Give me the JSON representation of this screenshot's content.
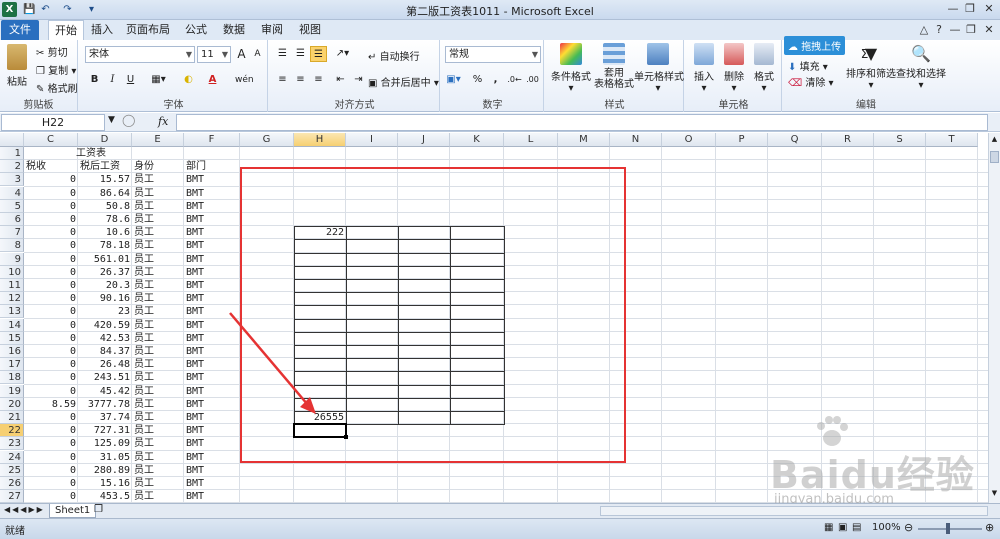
{
  "window": {
    "title": "第二版工资表1011 - Microsoft Excel"
  },
  "tabs": [
    "文件",
    "开始",
    "插入",
    "页面布局",
    "公式",
    "数据",
    "审阅",
    "视图"
  ],
  "ribbon": {
    "clipboard": {
      "paste": "粘贴",
      "cut": "剪切",
      "copy": "复制",
      "format_painter": "格式刷",
      "label": "剪贴板"
    },
    "font": {
      "name": "宋体",
      "size": "11",
      "bold": "B",
      "italic": "I",
      "underline": "U",
      "label": "字体",
      "grow": "A",
      "shrink": "A",
      "wen": "wén"
    },
    "alignment": {
      "wrap": "自动换行",
      "merge": "合并后居中",
      "label": "对齐方式"
    },
    "number": {
      "format": "常规",
      "percent": "%",
      "comma": ",",
      "label": "数字"
    },
    "styles": {
      "conditional": "条件格式",
      "table1": "套用",
      "table2": "表格格式",
      "cell_styles": "单元格样式",
      "label": "样式"
    },
    "cells": {
      "insert": "插入",
      "delete": "删除",
      "format": "格式",
      "label": "单元格"
    },
    "editing": {
      "baidu": "拖拽上传",
      "fill": "填充",
      "clear": "清除",
      "sort": "排序和筛选",
      "find": "查找和选择",
      "label": "编辑",
      "sum": "Σ"
    }
  },
  "formula_bar": {
    "name_box": "H22",
    "fx": "fx",
    "formula": ""
  },
  "columns": [
    "C",
    "D",
    "E",
    "F",
    "G",
    "H",
    "I",
    "J",
    "K",
    "L",
    "M",
    "N",
    "O",
    "P",
    "Q",
    "R",
    "S",
    "T"
  ],
  "sheet": {
    "title": "工资表",
    "headers": {
      "C": "税收",
      "D": "税后工资",
      "E": "身份",
      "F": "部门"
    },
    "rows": [
      {
        "r": 3,
        "C": "0",
        "D": "15.57",
        "E": "员工",
        "F": "BMT"
      },
      {
        "r": 4,
        "C": "0",
        "D": "86.64",
        "E": "员工",
        "F": "BMT"
      },
      {
        "r": 5,
        "C": "0",
        "D": "50.8",
        "E": "员工",
        "F": "BMT"
      },
      {
        "r": 6,
        "C": "0",
        "D": "78.6",
        "E": "员工",
        "F": "BMT"
      },
      {
        "r": 7,
        "C": "0",
        "D": "10.6",
        "E": "员工",
        "F": "BMT"
      },
      {
        "r": 8,
        "C": "0",
        "D": "78.18",
        "E": "员工",
        "F": "BMT"
      },
      {
        "r": 9,
        "C": "0",
        "D": "561.01",
        "E": "员工",
        "F": "BMT"
      },
      {
        "r": 10,
        "C": "0",
        "D": "26.37",
        "E": "员工",
        "F": "BMT"
      },
      {
        "r": 11,
        "C": "0",
        "D": "20.3",
        "E": "员工",
        "F": "BMT"
      },
      {
        "r": 12,
        "C": "0",
        "D": "90.16",
        "E": "员工",
        "F": "BMT"
      },
      {
        "r": 13,
        "C": "0",
        "D": "23",
        "E": "员工",
        "F": "BMT"
      },
      {
        "r": 14,
        "C": "0",
        "D": "420.59",
        "E": "员工",
        "F": "BMT"
      },
      {
        "r": 15,
        "C": "0",
        "D": "42.53",
        "E": "员工",
        "F": "BMT"
      },
      {
        "r": 16,
        "C": "0",
        "D": "84.37",
        "E": "员工",
        "F": "BMT"
      },
      {
        "r": 17,
        "C": "0",
        "D": "26.48",
        "E": "员工",
        "F": "BMT"
      },
      {
        "r": 18,
        "C": "0",
        "D": "243.51",
        "E": "员工",
        "F": "BMT"
      },
      {
        "r": 19,
        "C": "0",
        "D": "45.42",
        "E": "员工",
        "F": "BMT"
      },
      {
        "r": 20,
        "C": "8.59",
        "D": "3777.78",
        "E": "员工",
        "F": "BMT"
      },
      {
        "r": 21,
        "C": "0",
        "D": "37.74",
        "E": "员工",
        "F": "BMT"
      },
      {
        "r": 22,
        "C": "0",
        "D": "727.31",
        "E": "员工",
        "F": "BMT"
      },
      {
        "r": 23,
        "C": "0",
        "D": "125.09",
        "E": "员工",
        "F": "BMT"
      },
      {
        "r": 24,
        "C": "0",
        "D": "31.05",
        "E": "员工",
        "F": "BMT"
      },
      {
        "r": 25,
        "C": "0",
        "D": "280.89",
        "E": "员工",
        "F": "BMT"
      },
      {
        "r": 26,
        "C": "0",
        "D": "15.16",
        "E": "员工",
        "F": "BMT"
      },
      {
        "r": 27,
        "C": "0",
        "D": "453.5",
        "E": "员工",
        "F": "BMT"
      }
    ],
    "h7_value": "222",
    "h21_value": "26555",
    "active_cell": "H22",
    "active_row": 22,
    "active_col": "H"
  },
  "sheet_tab": "Sheet1",
  "status": {
    "text": "就绪",
    "zoom": "100%"
  },
  "watermark": {
    "main": "Baidu经验",
    "sub": "jingyan.baidu.com"
  },
  "colors": {
    "annotation": "#e53333",
    "file_tab": "#2a6fbf"
  }
}
